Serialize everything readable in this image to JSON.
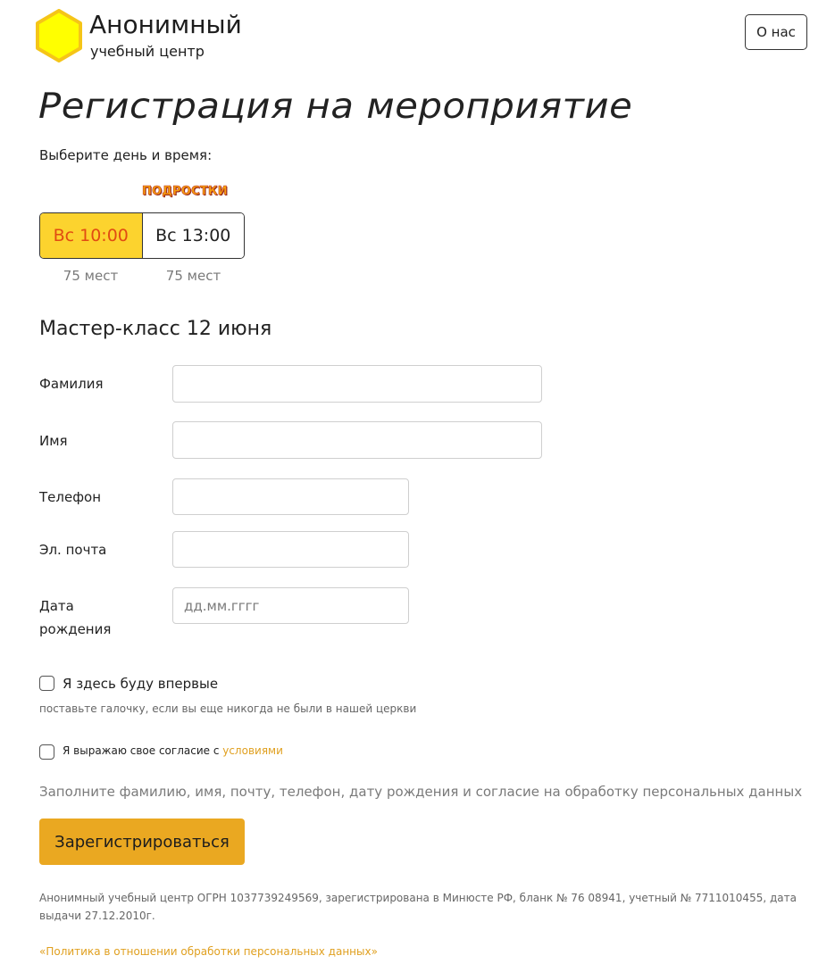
{
  "header": {
    "logo_icon": "yellow-hexagon-logo",
    "brand_name": "Анонимный",
    "brand_sub": "учебный центр",
    "about_label": "О нас"
  },
  "page": {
    "title": "Регистрация на мероприятие",
    "choose_label": "Выберите день и время:"
  },
  "slots": {
    "badge": "ПОДРОСТКИ",
    "items": [
      {
        "label": "Вс 10:00",
        "seats": "75 мест",
        "selected": true
      },
      {
        "label": "Вс 13:00",
        "seats": "75 мест",
        "selected": false
      }
    ]
  },
  "event": {
    "title": "Мастер-класс 12 июня"
  },
  "form": {
    "last_name_label": "Фамилия",
    "last_name_value": "",
    "first_name_label": "Имя",
    "first_name_value": "",
    "phone_label": "Телефон",
    "phone_value": "",
    "email_label": "Эл. почта",
    "email_value": "",
    "birth_label_line1": "Дата",
    "birth_label_line2": "рождения",
    "birth_placeholder": "дд.мм.гггг",
    "first_time_label": "Я здесь буду впервые",
    "first_time_checked": false,
    "first_time_hint": "поставьте галочку, если вы еще никогда не были в нашей церкви",
    "consent_text": "Я выражаю свое согласие с ",
    "consent_link": "условиями",
    "consent_checked": false,
    "fill_message": "Заполните фамилию, имя, почту, телефон, дату рождения и согласие на обработку персональных данных",
    "submit_label": "Зарегистрироваться"
  },
  "footer": {
    "legal_text": "Анонимный учебный центр ОГРН 1037739249569, зарегистрирована в Минюсте РФ, бланк № 76 08941, учетный № 7711010455, дата выдачи 27.12.2010г.",
    "policy_link": "«Политика в отношении обработки персональных данных»"
  },
  "colors": {
    "accent": "#eaa821",
    "selected_slot_bg": "#fcd32e",
    "selected_slot_text": "#e14b12",
    "link": "#e0a020",
    "logo_fill": "#ffff00",
    "logo_border": "#f5c518"
  }
}
